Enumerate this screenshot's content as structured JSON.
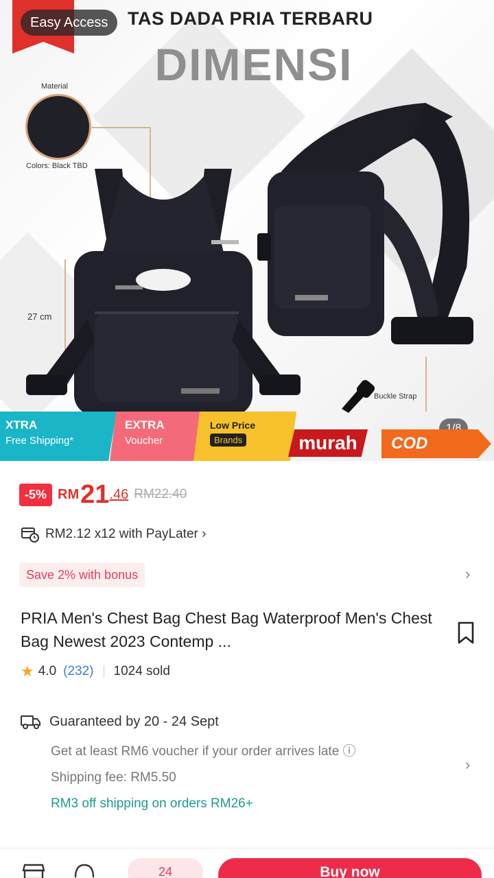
{
  "hero": {
    "easy_access_label": "Easy Access",
    "headline": "TAS DADA PRIA TERBARU",
    "section_title": "DIMENSI",
    "material_label": "Material",
    "color_label": "Colors: Black TBD",
    "size_label": "27 cm",
    "buckle_label": "Buckle Strap",
    "page_indicator": "1/8",
    "promos": {
      "xtra_top": "XTRA",
      "xtra_sub": "Free Shipping*",
      "extra_top": "EXTRA",
      "extra_sub": "Voucher",
      "low_top": "Low Price",
      "low_sub": "Brands",
      "murah": "murah",
      "cod": "COD"
    }
  },
  "price": {
    "discount": "-5%",
    "currency": "RM",
    "main": "21",
    "decimal": ".46",
    "original": "RM22.40"
  },
  "paylater": {
    "text": "RM2.12 x12 with PayLater ›"
  },
  "bonus": {
    "text": "Save 2% with bonus"
  },
  "product": {
    "title": "PRIA Men's Chest Bag Chest Bag Waterproof Men's Chest Bag Newest 2023 Contemp ...",
    "rating": "4.0",
    "reviews": "(232)",
    "sold": "1024 sold"
  },
  "shipping": {
    "guarantee": "Guaranteed by 20 - 24 Sept",
    "voucher_note": "Get at least RM6 voucher if your order arrives late ⓘ",
    "fee": "Shipping fee: RM5.50",
    "promo": "RM3 off shipping on orders RM26+"
  },
  "bottom_bar": {
    "pill_label": "24",
    "buy_label": "Buy now"
  },
  "colors": {
    "accent": "#e0302a",
    "buy_button": "#ee2c4a",
    "teal_promo": "#1d9b8f"
  }
}
